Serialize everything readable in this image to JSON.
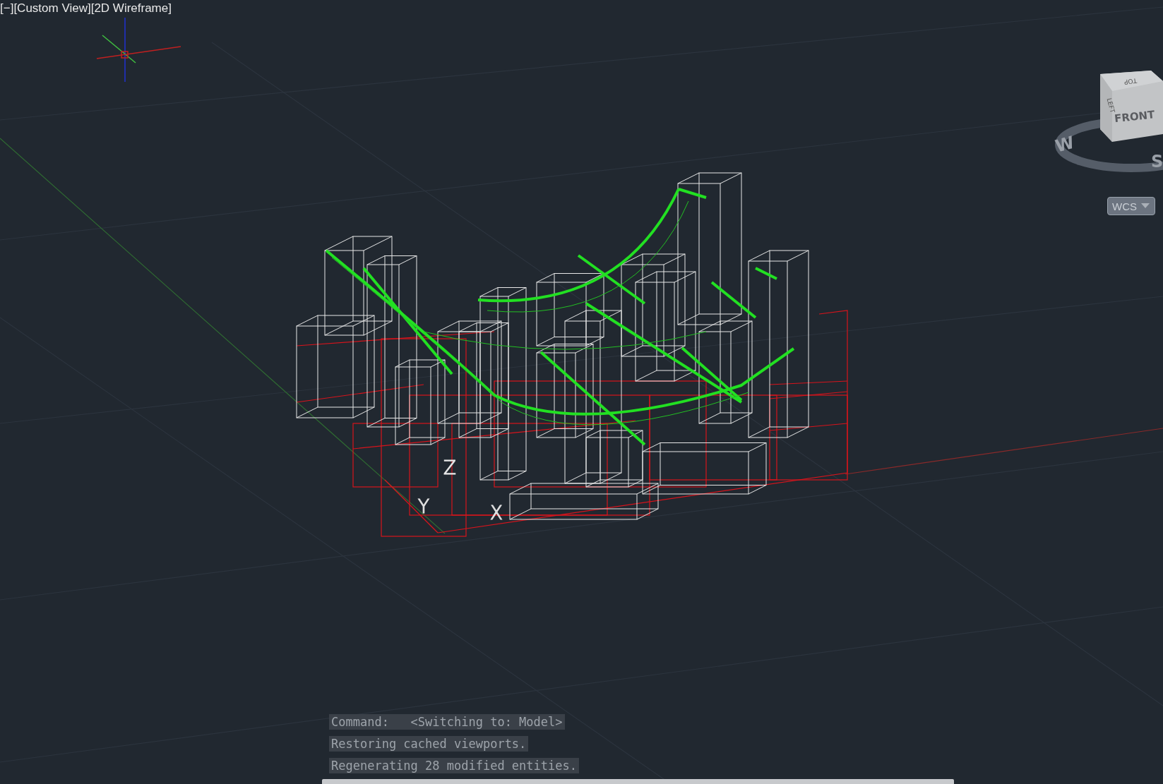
{
  "viewport_controls": [
    {
      "label": "[−]"
    },
    {
      "label": "[Custom View]"
    },
    {
      "label": "[2D Wireframe]"
    }
  ],
  "ucs_labels": {
    "z": "Z",
    "y": "Y",
    "x": "X"
  },
  "viewcube": {
    "top": "TOP",
    "left": "LEFT",
    "front": "FRONT",
    "compass": [
      "W",
      "S"
    ],
    "ucs_menu": "WCS"
  },
  "command_history": [
    "Command:   <Switching to: Model>",
    "Restoring cached viewports.",
    "Regenerating 28 modified entities."
  ]
}
